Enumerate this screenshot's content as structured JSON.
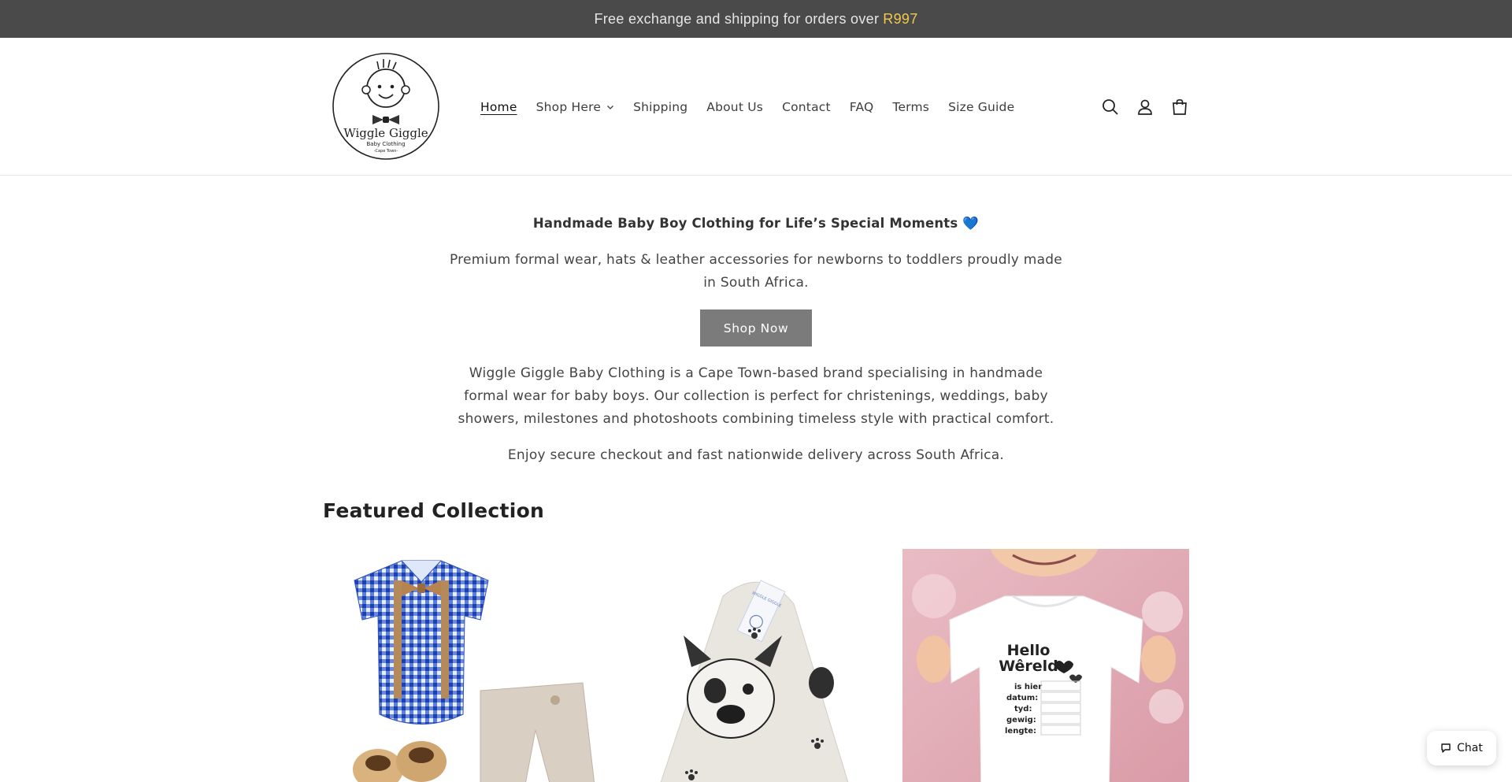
{
  "announcement": {
    "text": "Free exchange and shipping for orders over",
    "highlight": "R997",
    "highlight_color": "#f2c94c"
  },
  "header": {
    "logo": {
      "brand": "Wiggle Giggle",
      "line1": "Baby Clothing",
      "line2": "-Cape Town-"
    },
    "nav": [
      {
        "label": "Home",
        "active": true
      },
      {
        "label": "Shop Here",
        "has_dropdown": true
      },
      {
        "label": "Shipping"
      },
      {
        "label": "About Us"
      },
      {
        "label": "Contact"
      },
      {
        "label": "FAQ"
      },
      {
        "label": "Terms"
      },
      {
        "label": "Size Guide"
      }
    ],
    "icons": [
      "search-icon",
      "account-icon",
      "cart-icon"
    ]
  },
  "hero": {
    "title": "Handmade Baby Boy Clothing for Life’s Special Moments 💙",
    "subtitle": "Premium formal wear, hats & leather accessories for newborns to toddlers proudly made in South Africa.",
    "button_label": "Shop Now",
    "body": "Wiggle Giggle Baby Clothing is a Cape Town-based brand specialising in handmade formal wear for baby boys. Our collection is perfect for christenings, weddings, baby showers, milestones and photoshoots combining timeless style with practical comfort.",
    "note": "Enjoy secure checkout and fast nationwide delivery across South Africa."
  },
  "featured": {
    "title": "Featured Collection",
    "products": [
      {
        "image": "blue-gingham-romper-outfit"
      },
      {
        "image": "french-bulldog-print-bib",
        "tag_text": "WIGGLE GIGGLE"
      },
      {
        "image": "hello-wereld-onesie",
        "onesie_title_1": "Hello",
        "onesie_title_2": "Wêreld",
        "onesie_lines": [
          "is hier",
          "datum:",
          "tyd:",
          "gewig:",
          "lengte:"
        ]
      }
    ]
  },
  "chat": {
    "label": "Chat"
  },
  "colors": {
    "announcement_bg": "#4a4a4a",
    "button_bg": "#7b7b7b",
    "text": "#444444"
  }
}
